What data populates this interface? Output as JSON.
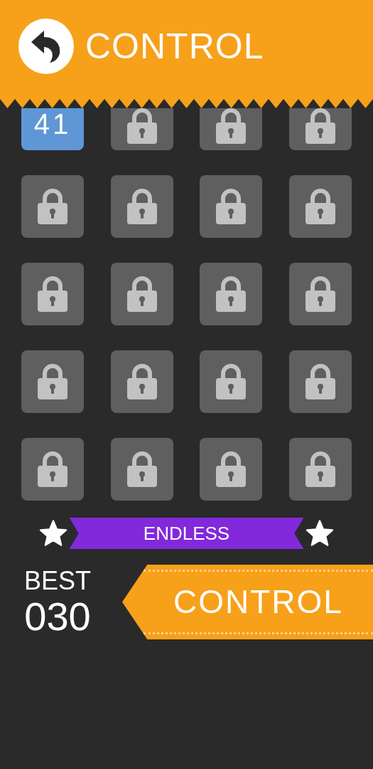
{
  "header": {
    "title": "CONTROL"
  },
  "levels": [
    {
      "kind": "level",
      "label": "41"
    },
    {
      "kind": "locked"
    },
    {
      "kind": "locked"
    },
    {
      "kind": "locked"
    },
    {
      "kind": "locked"
    },
    {
      "kind": "locked"
    },
    {
      "kind": "locked"
    },
    {
      "kind": "locked"
    },
    {
      "kind": "locked"
    },
    {
      "kind": "locked"
    },
    {
      "kind": "locked"
    },
    {
      "kind": "locked"
    },
    {
      "kind": "locked"
    },
    {
      "kind": "locked"
    },
    {
      "kind": "locked"
    },
    {
      "kind": "locked"
    },
    {
      "kind": "locked"
    },
    {
      "kind": "locked"
    },
    {
      "kind": "locked"
    },
    {
      "kind": "locked"
    }
  ],
  "mode_banner": {
    "label": "ENDLESS"
  },
  "best": {
    "label": "BEST",
    "score": "030"
  },
  "play_button": {
    "label": "CONTROL"
  }
}
